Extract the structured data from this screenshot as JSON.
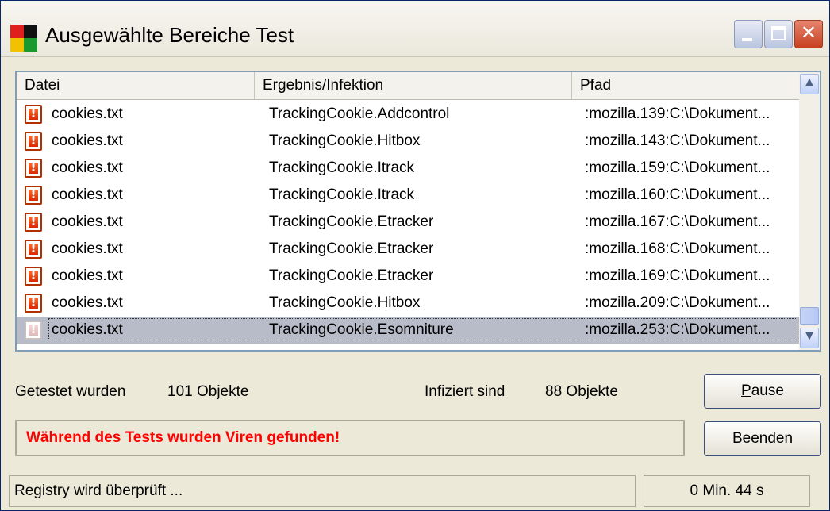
{
  "window": {
    "title": "Ausgewählte Bereiche Test"
  },
  "list": {
    "columns": [
      "Datei",
      "Ergebnis/Infektion",
      "Pfad"
    ],
    "rows": [
      {
        "file": "cookies.txt",
        "result": "TrackingCookie.Addcontrol",
        "path": ":mozilla.139:C:\\Dokument..."
      },
      {
        "file": "cookies.txt",
        "result": "TrackingCookie.Hitbox",
        "path": ":mozilla.143:C:\\Dokument..."
      },
      {
        "file": "cookies.txt",
        "result": "TrackingCookie.Itrack",
        "path": ":mozilla.159:C:\\Dokument..."
      },
      {
        "file": "cookies.txt",
        "result": "TrackingCookie.Itrack",
        "path": ":mozilla.160:C:\\Dokument..."
      },
      {
        "file": "cookies.txt",
        "result": "TrackingCookie.Etracker",
        "path": ":mozilla.167:C:\\Dokument..."
      },
      {
        "file": "cookies.txt",
        "result": "TrackingCookie.Etracker",
        "path": ":mozilla.168:C:\\Dokument..."
      },
      {
        "file": "cookies.txt",
        "result": "TrackingCookie.Etracker",
        "path": ":mozilla.169:C:\\Dokument..."
      },
      {
        "file": "cookies.txt",
        "result": "TrackingCookie.Hitbox",
        "path": ":mozilla.209:C:\\Dokument..."
      },
      {
        "file": "cookies.txt",
        "result": "TrackingCookie.Esomniture",
        "path": ":mozilla.253:C:\\Dokument..."
      }
    ],
    "selected_row": 8,
    "row_icon": "infected-file-icon"
  },
  "stats": {
    "tested_label": "Getestet wurden",
    "tested_value": "101 Objekte",
    "infected_label": "Infiziert sind",
    "infected_value": "88 Objekte"
  },
  "buttons": {
    "pause_accel": "P",
    "pause_rest": "ause",
    "stop_accel": "B",
    "stop_rest": "eenden"
  },
  "message": "Während des Tests wurden Viren gefunden!",
  "status": {
    "left": "Registry wird überprüft ...",
    "right": "0 Min. 44 s"
  },
  "colors": {
    "message": "#ff0000",
    "selection": "#b8bcc8",
    "close_button": "#c7401f"
  }
}
